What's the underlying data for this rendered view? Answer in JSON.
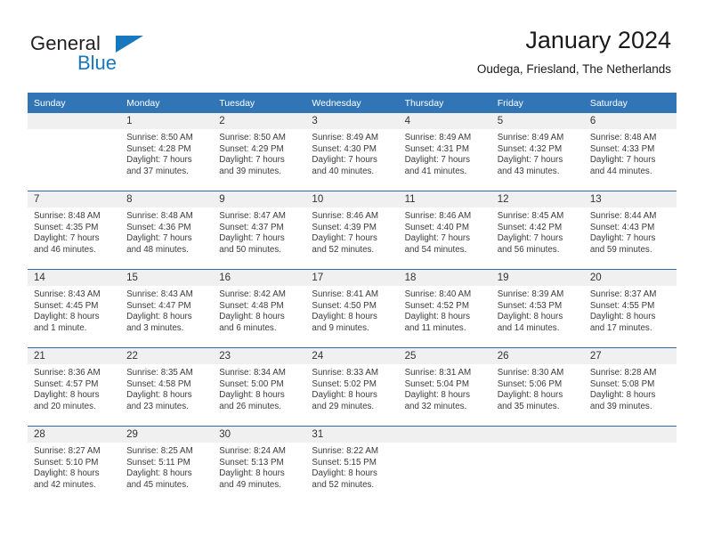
{
  "brand": {
    "name_part1": "General",
    "name_part2": "Blue",
    "accent_color": "#1878be"
  },
  "header": {
    "title": "January 2024",
    "subtitle": "Oudega, Friesland, The Netherlands"
  },
  "theme": {
    "header_row_color": "#3275b7",
    "daynum_band_color": "#f0f0f0",
    "week_divider_color": "#2d6ca8"
  },
  "weekday_headers": [
    "Sunday",
    "Monday",
    "Tuesday",
    "Wednesday",
    "Thursday",
    "Friday",
    "Saturday"
  ],
  "weeks": [
    [
      {
        "day": "",
        "empty": true,
        "sunrise": "",
        "sunset": "",
        "daylight1": "",
        "daylight2": ""
      },
      {
        "day": "1",
        "sunrise": "Sunrise: 8:50 AM",
        "sunset": "Sunset: 4:28 PM",
        "daylight1": "Daylight: 7 hours",
        "daylight2": "and 37 minutes."
      },
      {
        "day": "2",
        "sunrise": "Sunrise: 8:50 AM",
        "sunset": "Sunset: 4:29 PM",
        "daylight1": "Daylight: 7 hours",
        "daylight2": "and 39 minutes."
      },
      {
        "day": "3",
        "sunrise": "Sunrise: 8:49 AM",
        "sunset": "Sunset: 4:30 PM",
        "daylight1": "Daylight: 7 hours",
        "daylight2": "and 40 minutes."
      },
      {
        "day": "4",
        "sunrise": "Sunrise: 8:49 AM",
        "sunset": "Sunset: 4:31 PM",
        "daylight1": "Daylight: 7 hours",
        "daylight2": "and 41 minutes."
      },
      {
        "day": "5",
        "sunrise": "Sunrise: 8:49 AM",
        "sunset": "Sunset: 4:32 PM",
        "daylight1": "Daylight: 7 hours",
        "daylight2": "and 43 minutes."
      },
      {
        "day": "6",
        "sunrise": "Sunrise: 8:48 AM",
        "sunset": "Sunset: 4:33 PM",
        "daylight1": "Daylight: 7 hours",
        "daylight2": "and 44 minutes."
      }
    ],
    [
      {
        "day": "7",
        "sunrise": "Sunrise: 8:48 AM",
        "sunset": "Sunset: 4:35 PM",
        "daylight1": "Daylight: 7 hours",
        "daylight2": "and 46 minutes."
      },
      {
        "day": "8",
        "sunrise": "Sunrise: 8:48 AM",
        "sunset": "Sunset: 4:36 PM",
        "daylight1": "Daylight: 7 hours",
        "daylight2": "and 48 minutes."
      },
      {
        "day": "9",
        "sunrise": "Sunrise: 8:47 AM",
        "sunset": "Sunset: 4:37 PM",
        "daylight1": "Daylight: 7 hours",
        "daylight2": "and 50 minutes."
      },
      {
        "day": "10",
        "sunrise": "Sunrise: 8:46 AM",
        "sunset": "Sunset: 4:39 PM",
        "daylight1": "Daylight: 7 hours",
        "daylight2": "and 52 minutes."
      },
      {
        "day": "11",
        "sunrise": "Sunrise: 8:46 AM",
        "sunset": "Sunset: 4:40 PM",
        "daylight1": "Daylight: 7 hours",
        "daylight2": "and 54 minutes."
      },
      {
        "day": "12",
        "sunrise": "Sunrise: 8:45 AM",
        "sunset": "Sunset: 4:42 PM",
        "daylight1": "Daylight: 7 hours",
        "daylight2": "and 56 minutes."
      },
      {
        "day": "13",
        "sunrise": "Sunrise: 8:44 AM",
        "sunset": "Sunset: 4:43 PM",
        "daylight1": "Daylight: 7 hours",
        "daylight2": "and 59 minutes."
      }
    ],
    [
      {
        "day": "14",
        "sunrise": "Sunrise: 8:43 AM",
        "sunset": "Sunset: 4:45 PM",
        "daylight1": "Daylight: 8 hours",
        "daylight2": "and 1 minute."
      },
      {
        "day": "15",
        "sunrise": "Sunrise: 8:43 AM",
        "sunset": "Sunset: 4:47 PM",
        "daylight1": "Daylight: 8 hours",
        "daylight2": "and 3 minutes."
      },
      {
        "day": "16",
        "sunrise": "Sunrise: 8:42 AM",
        "sunset": "Sunset: 4:48 PM",
        "daylight1": "Daylight: 8 hours",
        "daylight2": "and 6 minutes."
      },
      {
        "day": "17",
        "sunrise": "Sunrise: 8:41 AM",
        "sunset": "Sunset: 4:50 PM",
        "daylight1": "Daylight: 8 hours",
        "daylight2": "and 9 minutes."
      },
      {
        "day": "18",
        "sunrise": "Sunrise: 8:40 AM",
        "sunset": "Sunset: 4:52 PM",
        "daylight1": "Daylight: 8 hours",
        "daylight2": "and 11 minutes."
      },
      {
        "day": "19",
        "sunrise": "Sunrise: 8:39 AM",
        "sunset": "Sunset: 4:53 PM",
        "daylight1": "Daylight: 8 hours",
        "daylight2": "and 14 minutes."
      },
      {
        "day": "20",
        "sunrise": "Sunrise: 8:37 AM",
        "sunset": "Sunset: 4:55 PM",
        "daylight1": "Daylight: 8 hours",
        "daylight2": "and 17 minutes."
      }
    ],
    [
      {
        "day": "21",
        "sunrise": "Sunrise: 8:36 AM",
        "sunset": "Sunset: 4:57 PM",
        "daylight1": "Daylight: 8 hours",
        "daylight2": "and 20 minutes."
      },
      {
        "day": "22",
        "sunrise": "Sunrise: 8:35 AM",
        "sunset": "Sunset: 4:58 PM",
        "daylight1": "Daylight: 8 hours",
        "daylight2": "and 23 minutes."
      },
      {
        "day": "23",
        "sunrise": "Sunrise: 8:34 AM",
        "sunset": "Sunset: 5:00 PM",
        "daylight1": "Daylight: 8 hours",
        "daylight2": "and 26 minutes."
      },
      {
        "day": "24",
        "sunrise": "Sunrise: 8:33 AM",
        "sunset": "Sunset: 5:02 PM",
        "daylight1": "Daylight: 8 hours",
        "daylight2": "and 29 minutes."
      },
      {
        "day": "25",
        "sunrise": "Sunrise: 8:31 AM",
        "sunset": "Sunset: 5:04 PM",
        "daylight1": "Daylight: 8 hours",
        "daylight2": "and 32 minutes."
      },
      {
        "day": "26",
        "sunrise": "Sunrise: 8:30 AM",
        "sunset": "Sunset: 5:06 PM",
        "daylight1": "Daylight: 8 hours",
        "daylight2": "and 35 minutes."
      },
      {
        "day": "27",
        "sunrise": "Sunrise: 8:28 AM",
        "sunset": "Sunset: 5:08 PM",
        "daylight1": "Daylight: 8 hours",
        "daylight2": "and 39 minutes."
      }
    ],
    [
      {
        "day": "28",
        "sunrise": "Sunrise: 8:27 AM",
        "sunset": "Sunset: 5:10 PM",
        "daylight1": "Daylight: 8 hours",
        "daylight2": "and 42 minutes."
      },
      {
        "day": "29",
        "sunrise": "Sunrise: 8:25 AM",
        "sunset": "Sunset: 5:11 PM",
        "daylight1": "Daylight: 8 hours",
        "daylight2": "and 45 minutes."
      },
      {
        "day": "30",
        "sunrise": "Sunrise: 8:24 AM",
        "sunset": "Sunset: 5:13 PM",
        "daylight1": "Daylight: 8 hours",
        "daylight2": "and 49 minutes."
      },
      {
        "day": "31",
        "sunrise": "Sunrise: 8:22 AM",
        "sunset": "Sunset: 5:15 PM",
        "daylight1": "Daylight: 8 hours",
        "daylight2": "and 52 minutes."
      },
      {
        "day": "",
        "empty": true,
        "sunrise": "",
        "sunset": "",
        "daylight1": "",
        "daylight2": ""
      },
      {
        "day": "",
        "empty": true,
        "sunrise": "",
        "sunset": "",
        "daylight1": "",
        "daylight2": ""
      },
      {
        "day": "",
        "empty": true,
        "sunrise": "",
        "sunset": "",
        "daylight1": "",
        "daylight2": ""
      }
    ]
  ]
}
